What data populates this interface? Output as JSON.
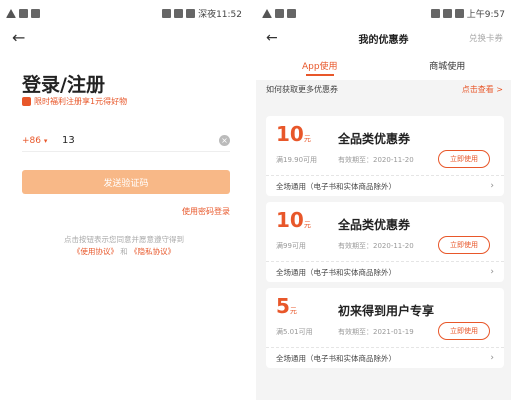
{
  "left": {
    "status": {
      "time": "深夜11:52"
    },
    "title": "登录/注册",
    "promo": "限时福利注册享1元得好物",
    "country_code": "+86",
    "phone_value": "13",
    "send_code_label": "发送验证码",
    "password_login": "使用密码登录",
    "agreement": {
      "line1": "点击按钮表示您同意并愿意遵守得到",
      "user_agreement": "《使用协议》",
      "and": "和",
      "privacy": "《隐私协议》"
    }
  },
  "right": {
    "status": {
      "time": "上午9:57"
    },
    "title": "我的优惠券",
    "redeem": "兑换卡券",
    "tabs": [
      {
        "label": "App使用",
        "active": true
      },
      {
        "label": "商城使用",
        "active": false
      }
    ],
    "howto": "如何获取更多优惠券",
    "howto_link": "点击查看 >",
    "coupons": [
      {
        "amount": "10",
        "unit": "元",
        "name": "全品类优惠券",
        "condition": "满19.90可用",
        "expiry": "有效期至：2020-11-20",
        "button": "立即使用",
        "scope": "全场通用（电子书和实体商品除外）"
      },
      {
        "amount": "10",
        "unit": "元",
        "name": "全品类优惠券",
        "condition": "满99可用",
        "expiry": "有效期至：2020-11-20",
        "button": "立即使用",
        "scope": "全场通用（电子书和实体商品除外）"
      },
      {
        "amount": "5",
        "unit": "元",
        "name": "初来得到用户专享",
        "condition": "满5.01可用",
        "expiry": "有效期至：2021-01-19",
        "button": "立即使用",
        "scope": "全场通用（电子书和实体商品除外）"
      }
    ]
  },
  "colors": {
    "accent": "#e8572a",
    "button_disabled": "#f8b887"
  }
}
